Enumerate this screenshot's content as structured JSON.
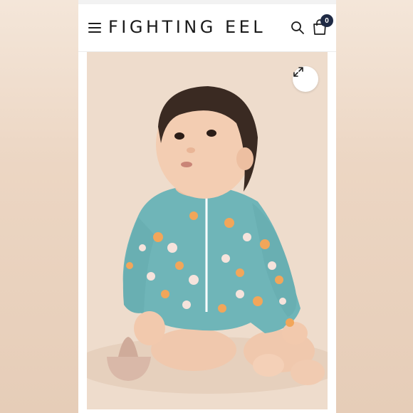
{
  "header": {
    "brand": "FIGHTING EEL",
    "cart_count": "0",
    "icons": [
      "hamburger-menu-icon",
      "search-icon",
      "shopping-bag-icon"
    ]
  },
  "product_image": {
    "expand_icon": "expand-arrows-icon",
    "swimsuit_color": "#6fb5b8",
    "background_color": "#eedccc"
  }
}
